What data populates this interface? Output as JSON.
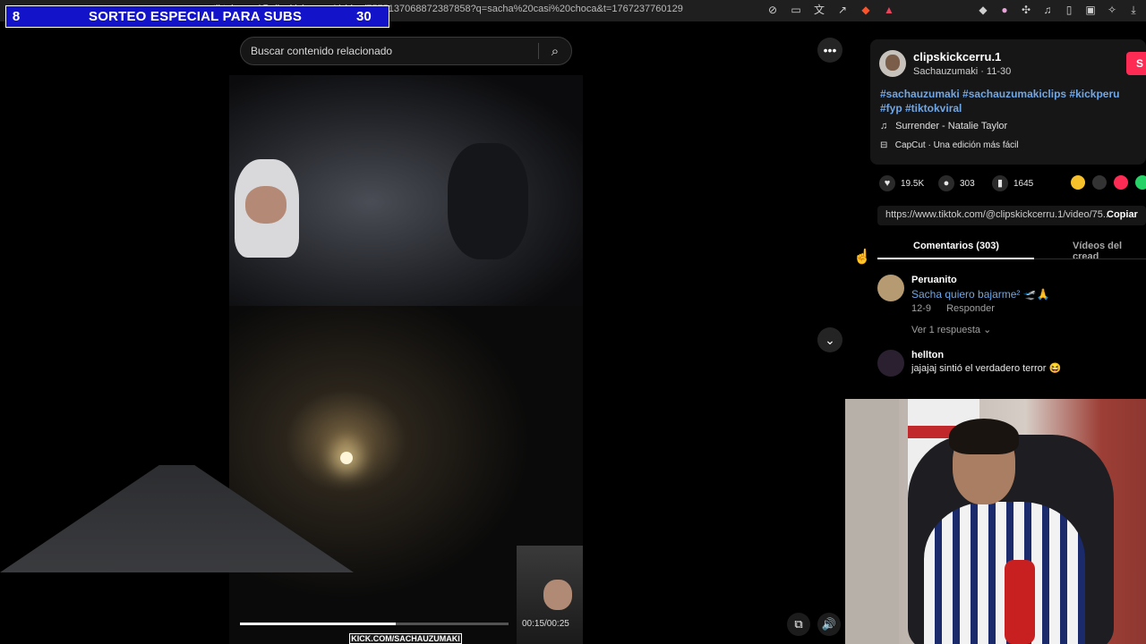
{
  "browser": {
    "url": "tiktok.com/@clipskickcerru.1/video/7575137068872387858?q=sacha%20casi%20choca&t=1767237760129"
  },
  "giveaway": {
    "number": "8",
    "title": "SORTEO ESPECIAL PARA SUBS",
    "count": "30",
    "progress": 0.25
  },
  "search": {
    "placeholder": "Buscar contenido relacionado"
  },
  "video": {
    "time": "00:15/00:25",
    "progress": 0.58,
    "watermark": "KICK.COM/SACHAUZUMAKI"
  },
  "post": {
    "username": "clipskickcerru.1",
    "meta": "Sachauzumaki · 11-30",
    "follow_label": "S",
    "hashtags": "#sachauzumaki #sachauzumakiclips #kickperu #fyp #tiktokviral",
    "music": "Surrender - Natalie Taylor",
    "capcut": "CapCut · Una edición más fácil",
    "likes": "19.5K",
    "comments": "303",
    "saves": "1645",
    "link": "https://www.tiktok.com/@clipskickcerru.1/video/75...",
    "copy_label": "Copiar"
  },
  "tabs": [
    {
      "label": "Comentarios (303)"
    },
    {
      "label": "Vídeos del cread"
    }
  ],
  "comments": [
    {
      "user": "Peruanito",
      "text": "Sacha quiero bajarme² 🛫🙏",
      "date": "12-9",
      "reply": "Responder",
      "replies": "Ver 1 respuesta ⌄"
    },
    {
      "user": "hellton",
      "text": "jajajaj sintió el verdadero terror 😆"
    }
  ],
  "colors": {
    "accent": "#fe2c55",
    "hashtag": "#6ea7e8",
    "giveaway_bg": "#1313c9"
  }
}
